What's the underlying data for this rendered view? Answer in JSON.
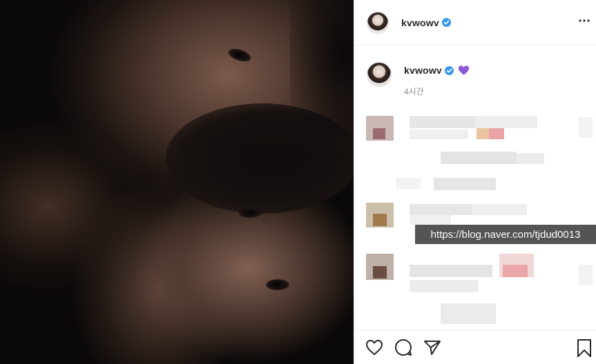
{
  "post": {
    "username": "kvwowv",
    "verified": true,
    "more_icon": "more-horizontal-icon"
  },
  "caption": {
    "username": "kvwowv",
    "emoji": "purple-heart",
    "time": "4시간"
  },
  "actions": {
    "like_icon": "heart-outline-icon",
    "comment_icon": "comment-bubble-icon",
    "share_icon": "paper-plane-icon",
    "save_icon": "bookmark-outline-icon"
  },
  "watermark": "https://blog.naver.com/tjdud0013",
  "colors": {
    "verified": "#3897f0",
    "heart": "#8c5cd6",
    "border": "#efefef"
  }
}
